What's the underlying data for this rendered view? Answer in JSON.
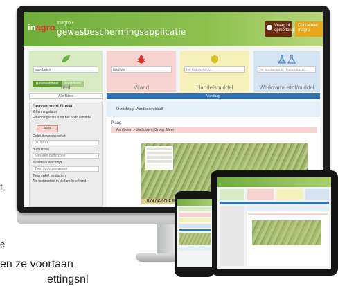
{
  "background_text": {
    "line1": "t",
    "line2": "e",
    "line3": "en ze voortaan",
    "line4": "ettingsnl"
  },
  "app": {
    "logo_prefix": "in",
    "logo_suffix": "agro",
    "title_small": "Inagro •",
    "title": "gewasbeschermingsapplicatie",
    "btn_question": "Vraag of opmerking?",
    "btn_contact": "Contacteer Inagro"
  },
  "categories": {
    "teelt": {
      "label": "Teelt",
      "input_value": "aardbeien",
      "btn_active": "Basisteelt/teelt",
      "btn_secondary": "Teeltklasse"
    },
    "vijand": {
      "label": "Vijand",
      "input_value": "bladluis"
    },
    "handelsmiddel": {
      "label": "Handelsmiddel",
      "placeholder": "bv. Kobra, Acco..."
    },
    "werkzame_stof": {
      "label": "Werkzame stof/middel",
      "placeholder": "bv. acetamiprid, thiabendazol..."
    }
  },
  "toolbar": {
    "alle_filters": "Alle filters",
    "vandaag": "Vandaag"
  },
  "sidebar": {
    "title": "Geavanceerd filteren",
    "items": [
      "Erkenningstatus",
      "Erkenningsstatus op het opdrukmiddel",
      "Gebruiksvoorschriften",
      "Bufferzone",
      "Maximale wachttijd",
      "Toon enkel producten",
      "Als teeltmiddel in de familie erkend"
    ],
    "chip": "- Alles -",
    "fields": [
      "bv. 50 m",
      "Kies een bufferzone",
      "Toon in de gewassen"
    ]
  },
  "main": {
    "search_info": "U zocht op 'Aardbeien bladl'",
    "plaag_label": "Plaag",
    "plaag_row": "Aardbeien > bladluizen | Groep: Meer",
    "bio_label": "BIOLOGISCHE BESTRIJDERS"
  },
  "colors": {
    "brand_green": "#6fae3c",
    "teelt": "#d8ebc5",
    "vijand": "#f7d3cf",
    "handelsmiddel": "#f6f1b8",
    "werkzame_stof": "#d5e4f3",
    "accent_blue": "#2f74b6"
  },
  "icons": {
    "teelt": "leaf-icon",
    "vijand": "bug-icon",
    "handelsmiddel": "shield-icon",
    "werkzame_stof": "flask-icon"
  }
}
